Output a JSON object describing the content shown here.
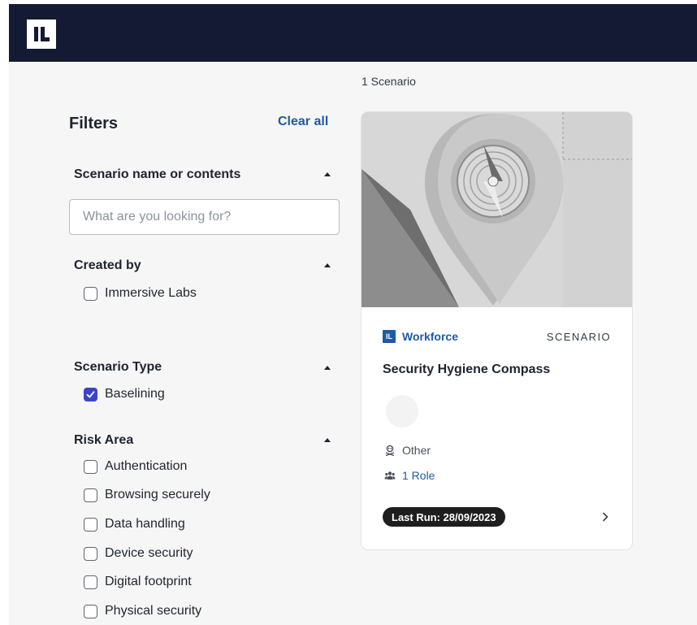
{
  "header": {
    "logo_text": "IL"
  },
  "results": {
    "count_label": "1 Scenario"
  },
  "filters": {
    "title": "Filters",
    "clear_all": "Clear all",
    "sections": [
      {
        "title": "Scenario name or contents",
        "search_placeholder": "What are you looking for?",
        "search_value": ""
      },
      {
        "title": "Created by",
        "options": [
          {
            "label": "Immersive Labs",
            "checked": false
          }
        ]
      },
      {
        "title": "Scenario Type",
        "options": [
          {
            "label": "Baselining",
            "checked": true
          }
        ]
      },
      {
        "title": "Risk Area",
        "options": [
          {
            "label": "Authentication",
            "checked": false
          },
          {
            "label": "Browsing securely",
            "checked": false
          },
          {
            "label": "Data handling",
            "checked": false
          },
          {
            "label": "Device security",
            "checked": false
          },
          {
            "label": "Digital footprint",
            "checked": false
          },
          {
            "label": "Physical security",
            "checked": false
          }
        ]
      }
    ]
  },
  "card": {
    "brand_badge": "IL",
    "brand_name": "Workforce",
    "type_label": "SCENARIO",
    "title": "Security Hygiene Compass",
    "category": "Other",
    "roles": "1 Role",
    "last_run": "Last Run: 28/09/2023",
    "image_icon": "compass-location-pin-image"
  },
  "colors": {
    "header_bg": "#141a33",
    "accent": "#1f5aa6",
    "checkbox_checked": "#3b44c7",
    "badge_bg": "#1e1e1e"
  }
}
